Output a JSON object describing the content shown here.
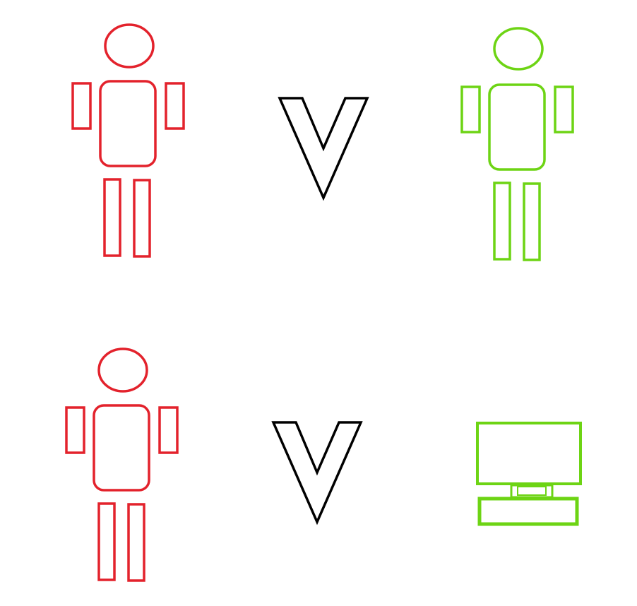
{
  "colors": {
    "human_red": "#e3222c",
    "human_green": "#6dd414",
    "computer_green": "#6dd414",
    "versus_black": "#000000",
    "background": "#ffffff"
  },
  "rows": [
    {
      "left": {
        "kind": "person",
        "color_key": "human_red",
        "icon": "person-icon"
      },
      "middle": {
        "kind": "versus",
        "icon": "versus-v-icon"
      },
      "right": {
        "kind": "person",
        "color_key": "human_green",
        "icon": "person-icon"
      }
    },
    {
      "left": {
        "kind": "person",
        "color_key": "human_red",
        "icon": "person-icon"
      },
      "middle": {
        "kind": "versus",
        "icon": "versus-v-icon"
      },
      "right": {
        "kind": "computer",
        "color_key": "computer_green",
        "icon": "computer-icon"
      }
    }
  ]
}
